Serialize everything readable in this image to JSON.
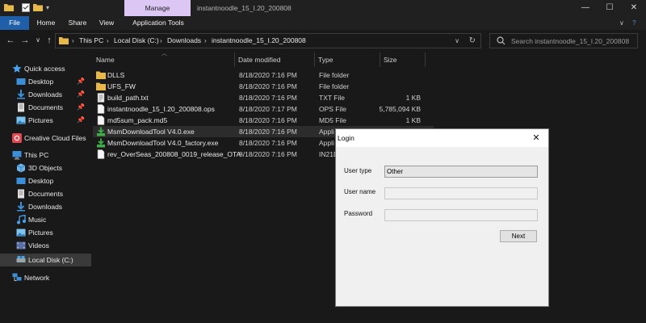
{
  "window": {
    "manage_tab": "Manage",
    "title": "instantnoodle_15_I.20_200808",
    "minimize": "—",
    "maximize": "☐",
    "close": "✕"
  },
  "ribbon": {
    "tabs": [
      "File",
      "Home",
      "Share",
      "View",
      "Application Tools"
    ],
    "collapse": "∨",
    "help": "?"
  },
  "nav": {
    "back": "←",
    "forward": "→",
    "recent": "∨",
    "up": "↑",
    "breadcrumb": [
      "This PC",
      "Local Disk (C:)",
      "Downloads",
      "instantnoodle_15_I.20_200808"
    ],
    "sep": "›",
    "dropdown": "∨",
    "refresh": "↻",
    "search_placeholder": "Search instantnoodle_15_I.20_200808"
  },
  "sidebar": {
    "items": [
      {
        "label": "Quick access",
        "icon": "star-icon"
      },
      {
        "label": "Desktop",
        "icon": "desktop-icon",
        "pinned": true
      },
      {
        "label": "Downloads",
        "icon": "download-icon",
        "pinned": true
      },
      {
        "label": "Documents",
        "icon": "documents-icon",
        "pinned": true
      },
      {
        "label": "Pictures",
        "icon": "pictures-icon",
        "pinned": true
      },
      {
        "label": "Creative Cloud Files",
        "icon": "creative-cloud-icon"
      },
      {
        "label": "This PC",
        "icon": "computer-icon"
      },
      {
        "label": "3D Objects",
        "icon": "cube-icon"
      },
      {
        "label": "Desktop",
        "icon": "desktop-icon"
      },
      {
        "label": "Documents",
        "icon": "documents-icon"
      },
      {
        "label": "Downloads",
        "icon": "download-icon"
      },
      {
        "label": "Music",
        "icon": "music-icon"
      },
      {
        "label": "Pictures",
        "icon": "pictures-icon"
      },
      {
        "label": "Videos",
        "icon": "videos-icon"
      },
      {
        "label": "Local Disk (C:)",
        "icon": "drive-icon"
      },
      {
        "label": "Network",
        "icon": "network-icon"
      }
    ],
    "pin": "📌"
  },
  "columns": {
    "name": "Name",
    "date": "Date modified",
    "type": "Type",
    "size": "Size"
  },
  "files": [
    {
      "name": "DLLS",
      "date": "8/18/2020 7:16 PM",
      "type": "File folder",
      "size": "",
      "icon": "folder-icon"
    },
    {
      "name": "UFS_FW",
      "date": "8/18/2020 7:16 PM",
      "type": "File folder",
      "size": "",
      "icon": "folder-icon"
    },
    {
      "name": "build_path.txt",
      "date": "8/18/2020 7:16 PM",
      "type": "TXT File",
      "size": "1 KB",
      "icon": "text-file-icon"
    },
    {
      "name": "instantnoodle_15_I.20_200808.ops",
      "date": "8/18/2020 7:17 PM",
      "type": "OPS File",
      "size": "5,785,094 KB",
      "icon": "file-icon"
    },
    {
      "name": "md5sum_pack.md5",
      "date": "8/18/2020 7:16 PM",
      "type": "MD5 File",
      "size": "1 KB",
      "icon": "file-icon"
    },
    {
      "name": "MsmDownloadTool V4.0.exe",
      "date": "8/18/2020 7:16 PM",
      "type": "Appli",
      "size": "",
      "icon": "app-icon"
    },
    {
      "name": "MsmDownloadTool V4.0_factory.exe",
      "date": "8/18/2020 7:16 PM",
      "type": "Appli",
      "size": "",
      "icon": "app-icon"
    },
    {
      "name": "rev_OverSeas_200808_0019_release_OTA-...",
      "date": "8/18/2020 7:16 PM",
      "type": "IN21D",
      "size": "",
      "icon": "file-icon"
    }
  ],
  "dialog": {
    "title": "Login",
    "close": "✕",
    "user_type_label": "User type",
    "user_type_value": "Other",
    "user_name_label": "User name",
    "password_label": "Password",
    "next_button": "Next"
  },
  "colors": {
    "accent": "#1f5faa",
    "manage_tab": "#dcc6f3",
    "folder": "#e8b84a"
  }
}
